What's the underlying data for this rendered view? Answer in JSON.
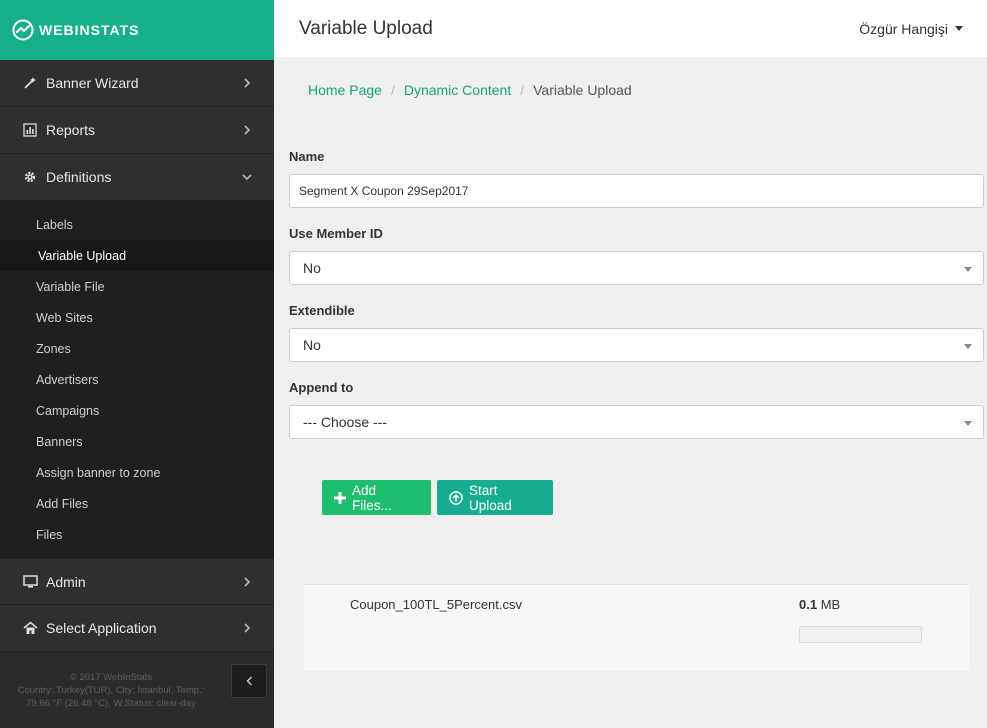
{
  "brand": {
    "name": "WEBINSTATS",
    "color": "#17b08b"
  },
  "header": {
    "title": "Variable Upload",
    "user": "Özgür Hangişi"
  },
  "sidebar": {
    "top_items": [
      {
        "label": "Banner Wizard",
        "icon": "magic-wand-icon",
        "expanded": false
      },
      {
        "label": "Reports",
        "icon": "bar-chart-icon",
        "expanded": false
      },
      {
        "label": "Definitions",
        "icon": "gear-icon",
        "expanded": true
      }
    ],
    "sub_items": [
      {
        "label": "Labels"
      },
      {
        "label": "Variable Upload",
        "active": true
      },
      {
        "label": "Variable File"
      },
      {
        "label": "Web Sites"
      },
      {
        "label": "Zones"
      },
      {
        "label": "Advertisers"
      },
      {
        "label": "Campaigns"
      },
      {
        "label": "Banners"
      },
      {
        "label": "Assign banner to zone"
      },
      {
        "label": "Add Files"
      },
      {
        "label": "Files"
      }
    ],
    "bottom_items": [
      {
        "label": "Admin",
        "icon": "monitor-icon"
      },
      {
        "label": "Select Application",
        "icon": "home-icon"
      }
    ],
    "footer": {
      "copyright": "© 2017 WebInStats",
      "weather_line1": "Country: Turkey(TUR), City: Istanbul, Temp.:",
      "weather_line2": "79.66 °F (26.48 °C), W.Status: clear-day"
    }
  },
  "breadcrumb": {
    "home": "Home Page",
    "section": "Dynamic Content",
    "current": "Variable Upload"
  },
  "form": {
    "name_label": "Name",
    "name_value": "Segment X Coupon 29Sep2017",
    "member_id_label": "Use Member ID",
    "member_id_value": "No",
    "extendible_label": "Extendible",
    "extendible_value": "No",
    "append_label": "Append to",
    "append_value": "--- Choose ---"
  },
  "buttons": {
    "add_files": "Add Files...",
    "start_upload": "Start Upload"
  },
  "upload": {
    "file_name": "Coupon_100TL_5Percent.csv",
    "size_value": "0.1",
    "size_unit": "MB",
    "progress_fraction": 0
  }
}
